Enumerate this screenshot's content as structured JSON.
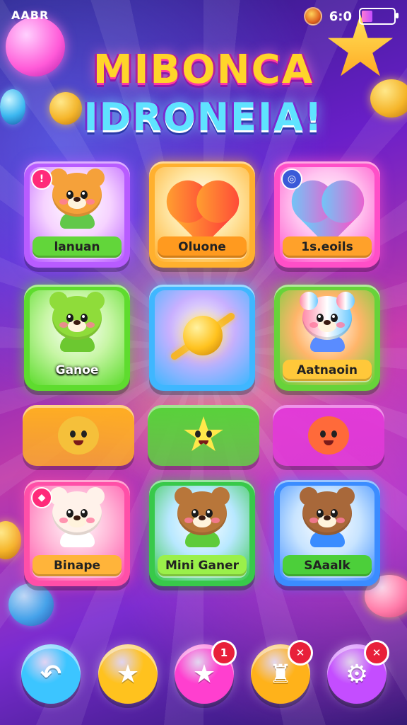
{
  "status_bar": {
    "left_text": "AABR",
    "time": "6:0",
    "battery_level": 0.35
  },
  "title": {
    "line1": "MIBONCA",
    "line2": "IDRONEIA!"
  },
  "tiles": [
    {
      "label": "lanuan",
      "badge": "!",
      "colors": {
        "frame": "#b85cff",
        "bg": "#f6d3ff",
        "label": "#62d63a"
      },
      "icon": "orange-bear-icon"
    },
    {
      "label": "Oluone",
      "colors": {
        "frame": "#ffb02e",
        "bg": "#ffe7a6",
        "label": "#ff9a1f"
      },
      "icon": "heart-icon"
    },
    {
      "label": "1s.eoils",
      "badge": "◎",
      "colors": {
        "frame": "#ff4fc8",
        "bg": "#ffc4f0",
        "label": "#ffa12a"
      },
      "icon": "blue-pink-heart-icon"
    },
    {
      "label": "Ganoe",
      "colors": {
        "frame": "#5edc2e",
        "bg": "#c8f6a6",
        "label": ""
      },
      "icon": "green-bear-icon"
    },
    {
      "label": "",
      "colors": {
        "frame": "#3fb7ff",
        "bg": "#c8b0ff",
        "label": ""
      },
      "icon": "gold-key-icon"
    },
    {
      "label": "Aatnaoin",
      "colors": {
        "frame": "#67d33a",
        "bg": "#ffb56a",
        "label": "#ffc83a"
      },
      "icon": "rainbow-bear-icon"
    },
    {
      "label": "Binape",
      "badge": "◆",
      "colors": {
        "frame": "#ff4fa8",
        "bg": "#ffb8d8",
        "label": "#ffb43a"
      },
      "icon": "white-bear-icon"
    },
    {
      "label": "Mini Ganer",
      "colors": {
        "frame": "#38c94a",
        "bg": "#b8e8ff",
        "label": "#9af04a"
      },
      "icon": "brown-bear-icon"
    },
    {
      "label": "SAaalk",
      "colors": {
        "frame": "#3b8cff",
        "bg": "#c8e4ff",
        "label": "#4ccf3a"
      },
      "icon": "brown-bear-blue-shirt-icon"
    }
  ],
  "pills": [
    {
      "icon": "yellow-bear-face-icon",
      "color": "#ffae22"
    },
    {
      "icon": "green-star-face-icon",
      "color": "#57d23a"
    },
    {
      "icon": "pink-bear-face-icon",
      "color": "#e23ad8"
    }
  ],
  "nav": [
    {
      "icon": "back-arrow-icon",
      "glyph": "↶",
      "color": "#3cc5ff",
      "badge": ""
    },
    {
      "icon": "star-icon",
      "glyph": "★",
      "color": "#ffc21e",
      "badge": ""
    },
    {
      "icon": "star-icon",
      "glyph": "★",
      "color": "#ff3fcf",
      "badge": "1"
    },
    {
      "icon": "trophy-icon",
      "glyph": "♜",
      "color": "#ffb21a",
      "badge": "✕"
    },
    {
      "icon": "gear-icon",
      "glyph": "⚙",
      "color": "#c44dff",
      "badge": "✕"
    }
  ]
}
